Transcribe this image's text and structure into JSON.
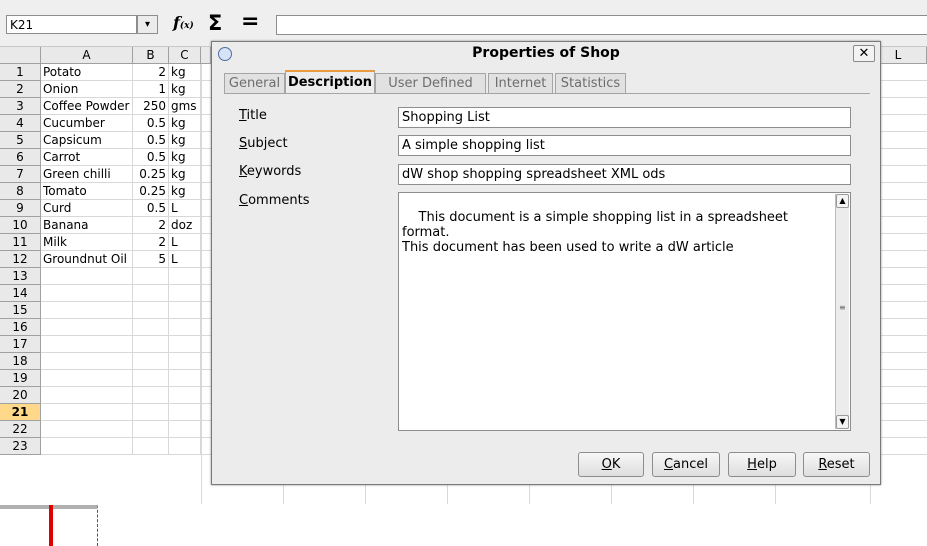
{
  "formula_bar": {
    "name_box": "K21",
    "name_box_arrow": "▾",
    "fx_label": "f",
    "fx_sub": "(x)",
    "sum_symbol": "Σ",
    "equals_symbol": "="
  },
  "sheet": {
    "columns": [
      "A",
      "B",
      "C",
      "L"
    ],
    "rows": [
      {
        "n": "1",
        "a": "Potato",
        "b": "2",
        "c": "kg"
      },
      {
        "n": "2",
        "a": "Onion",
        "b": "1",
        "c": "kg"
      },
      {
        "n": "3",
        "a": "Coffee Powder",
        "b": "250",
        "c": "gms"
      },
      {
        "n": "4",
        "a": "Cucumber",
        "b": "0.5",
        "c": "kg"
      },
      {
        "n": "5",
        "a": "Capsicum",
        "b": "0.5",
        "c": "kg"
      },
      {
        "n": "6",
        "a": "Carrot",
        "b": "0.5",
        "c": "kg"
      },
      {
        "n": "7",
        "a": "Green chilli",
        "b": "0.25",
        "c": "kg"
      },
      {
        "n": "8",
        "a": "Tomato",
        "b": "0.25",
        "c": "kg"
      },
      {
        "n": "9",
        "a": "Curd",
        "b": "0.5",
        "c": "L"
      },
      {
        "n": "10",
        "a": "Banana",
        "b": "2",
        "c": "doz"
      },
      {
        "n": "11",
        "a": "Milk",
        "b": "2",
        "c": "L"
      },
      {
        "n": "12",
        "a": "Groundnut Oil",
        "b": "5",
        "c": "L"
      },
      {
        "n": "13",
        "a": "",
        "b": "",
        "c": ""
      },
      {
        "n": "14",
        "a": "",
        "b": "",
        "c": ""
      },
      {
        "n": "15",
        "a": "",
        "b": "",
        "c": ""
      },
      {
        "n": "16",
        "a": "",
        "b": "",
        "c": ""
      },
      {
        "n": "17",
        "a": "",
        "b": "",
        "c": ""
      },
      {
        "n": "18",
        "a": "",
        "b": "",
        "c": ""
      },
      {
        "n": "19",
        "a": "",
        "b": "",
        "c": ""
      },
      {
        "n": "20",
        "a": "",
        "b": "",
        "c": ""
      },
      {
        "n": "21",
        "a": "",
        "b": "",
        "c": ""
      },
      {
        "n": "22",
        "a": "",
        "b": "",
        "c": ""
      },
      {
        "n": "23",
        "a": "",
        "b": "",
        "c": ""
      }
    ],
    "selected_row": "21",
    "page_break_color": "#e00000"
  },
  "dialog": {
    "title": "Properties of Shop",
    "close_label": "✕",
    "tabs": [
      "General",
      "Description",
      "User Defined",
      "Internet",
      "Statistics"
    ],
    "active_tab": "Description",
    "accent_color": "#e89c3f",
    "fields": {
      "title_label_key": "T",
      "title_label_rest": "itle",
      "title_value": "Shopping List",
      "subject_label_key": "S",
      "subject_label_rest": "ubject",
      "subject_value": "A simple shopping list",
      "keywords_label_key": "K",
      "keywords_label_rest": "eywords",
      "keywords_value": "dW shop shopping spreadsheet XML ods",
      "comments_label_key": "C",
      "comments_label_rest": "omments",
      "comments_value": "This document is a simple shopping list in a spreadsheet format.\nThis document has been used to write a dW article"
    },
    "buttons": {
      "ok_key": "O",
      "ok_rest": "K",
      "cancel_key": "C",
      "cancel_rest": "ancel",
      "help_key": "H",
      "help_rest": "elp",
      "reset_key": "R",
      "reset_rest": "eset"
    }
  }
}
